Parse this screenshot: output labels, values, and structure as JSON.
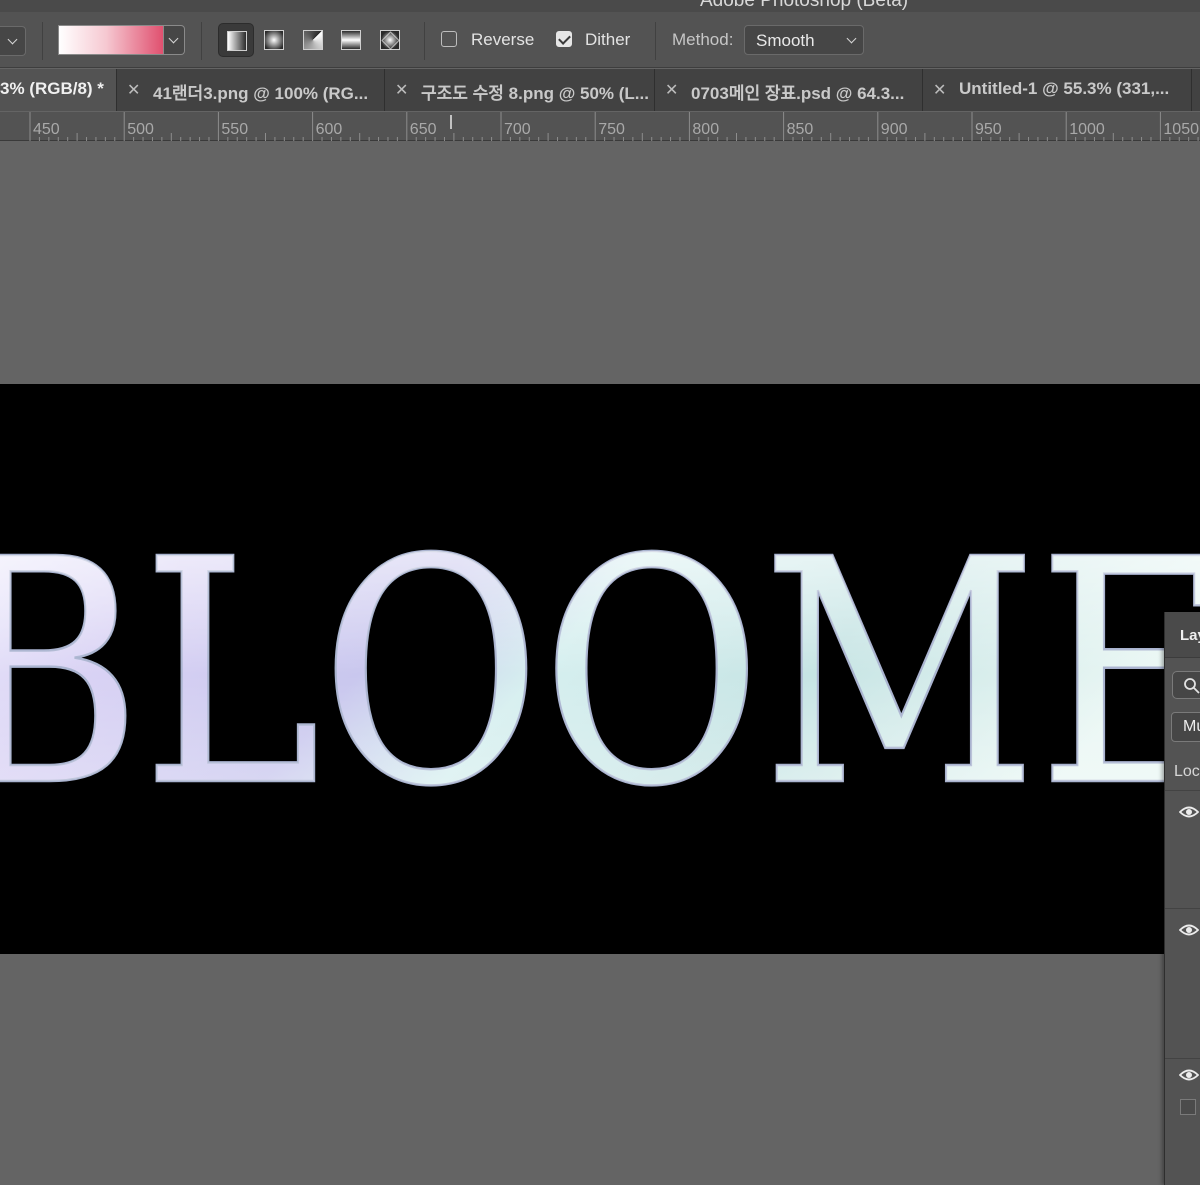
{
  "app": {
    "window_title": "Adobe Photoshop (Beta)"
  },
  "options_bar": {
    "gradient_colors": [
      "#ffffff",
      "#f6c9d2",
      "#e0506f"
    ],
    "gradient_types": [
      "linear",
      "radial",
      "angle",
      "reflected",
      "diamond"
    ],
    "selected_gradient_type": "linear",
    "reverse": {
      "label": "Reverse",
      "checked": false
    },
    "dither": {
      "label": "Dither",
      "checked": true
    },
    "method": {
      "label": "Method:",
      "value": "Smooth"
    }
  },
  "tabs": [
    {
      "label": "3% (RGB/8) *",
      "active": true,
      "closable": false
    },
    {
      "label": "41랜더3.png @ 100% (RG...",
      "active": false,
      "closable": true
    },
    {
      "label": "구조도 수정 8.png @ 50% (L...",
      "active": false,
      "closable": true
    },
    {
      "label": "0703메인 장표.psd @ 64.3...",
      "active": false,
      "closable": true
    },
    {
      "label": "Untitled-1 @ 55.3% (331,...",
      "active": false,
      "closable": true
    }
  ],
  "ruler": {
    "labels": [
      "450",
      "500",
      "550",
      "600",
      "650",
      "700",
      "750",
      "800",
      "850",
      "900",
      "950",
      "1000",
      "1050"
    ]
  },
  "canvas": {
    "background": "#000000",
    "artwork_text": "BLOOME",
    "artwork_colors": [
      "#f3f3ff",
      "#d9d2f4",
      "#c9c7ee",
      "#d6efef",
      "#eaf7f4"
    ]
  },
  "layers_panel": {
    "title": "Lay",
    "blend_mode": "Mu",
    "lock_label": "Loc"
  }
}
